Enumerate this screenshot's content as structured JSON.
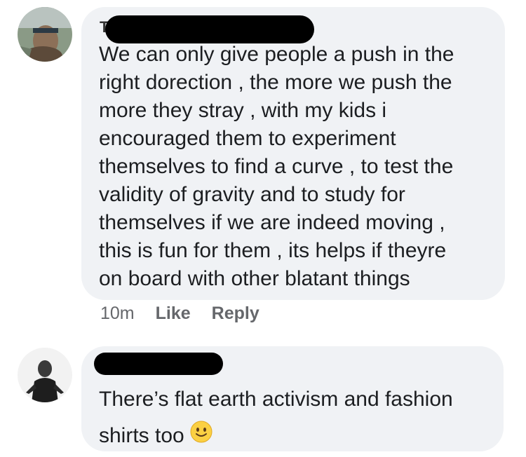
{
  "comments": [
    {
      "author_visible": "T",
      "text": "We can only give people a push in the\nright dorection , the more we push the\nmore they stray , with my kids i\nencouraged them to experiment\nthemselves to find a curve , to test the\nvalidity of gravity and to study for\nthemselves if we are indeed moving ,\nthis is fun for them , its helps if theyre\non board with other blatant things",
      "time": "10m",
      "like_label": "Like",
      "reply_label": "Reply"
    },
    {
      "text": "There’s flat earth activism and fashion\nshirts too",
      "emoji": "slightly-smiling-face-icon"
    }
  ],
  "colors": {
    "bubble": "#f0f2f5",
    "text": "#1c1e21",
    "meta": "#65676b",
    "redaction": "#000000"
  }
}
